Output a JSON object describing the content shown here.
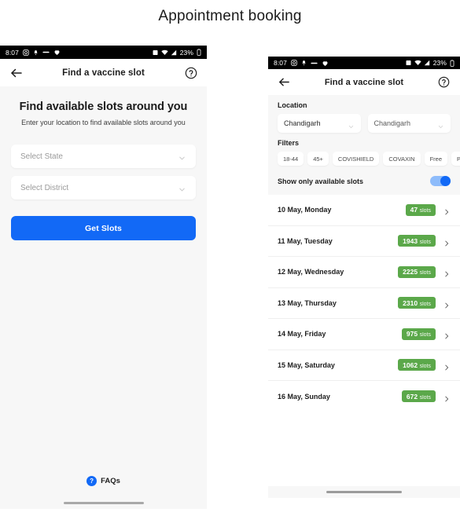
{
  "page": {
    "title": "Appointment booking"
  },
  "status_bar": {
    "time": "8:07",
    "battery_percent": "23%",
    "left_icons": [
      "camera-icon",
      "bell-icon",
      "dash-icon",
      "heart-icon"
    ],
    "right_icons": [
      "vibrate-icon",
      "wifi-icon",
      "signal-icon",
      "battery-icon"
    ]
  },
  "header": {
    "title": "Find a vaccine slot",
    "back_icon": "back-arrow-icon",
    "help_icon": "help-circle-icon"
  },
  "left_screen": {
    "hero_title": "Find available slots around you",
    "hero_subtitle": "Enter your location to find available slots around you",
    "state_select": {
      "placeholder": "Select State",
      "value": ""
    },
    "district_select": {
      "placeholder": "Select District",
      "value": ""
    },
    "cta_label": "Get Slots",
    "faq": {
      "badge": "?",
      "label": "FAQs"
    }
  },
  "right_screen": {
    "location_label": "Location",
    "state_value": "Chandigarh",
    "district_value": "Chandigarh",
    "filters_label": "Filters",
    "filters": [
      "18-44",
      "45+",
      "COVISHIELD",
      "COVAXIN",
      "Free",
      "Paid"
    ],
    "toggle_label": "Show only available slots",
    "toggle_state": "on",
    "slot_unit": "slots",
    "slots": [
      {
        "date": "10 May, Monday",
        "count": "47"
      },
      {
        "date": "11 May, Tuesday",
        "count": "1943"
      },
      {
        "date": "12 May, Wednesday",
        "count": "2225"
      },
      {
        "date": "13 May, Thursday",
        "count": "2310"
      },
      {
        "date": "14 May, Friday",
        "count": "975"
      },
      {
        "date": "15 May, Saturday",
        "count": "1062"
      },
      {
        "date": "16 May, Sunday",
        "count": "672"
      }
    ]
  },
  "colors": {
    "accent_blue": "#1269f6",
    "badge_green": "#5ba84a",
    "screen_bg": "#f7f7f7",
    "status_bar_bg": "#000000"
  }
}
